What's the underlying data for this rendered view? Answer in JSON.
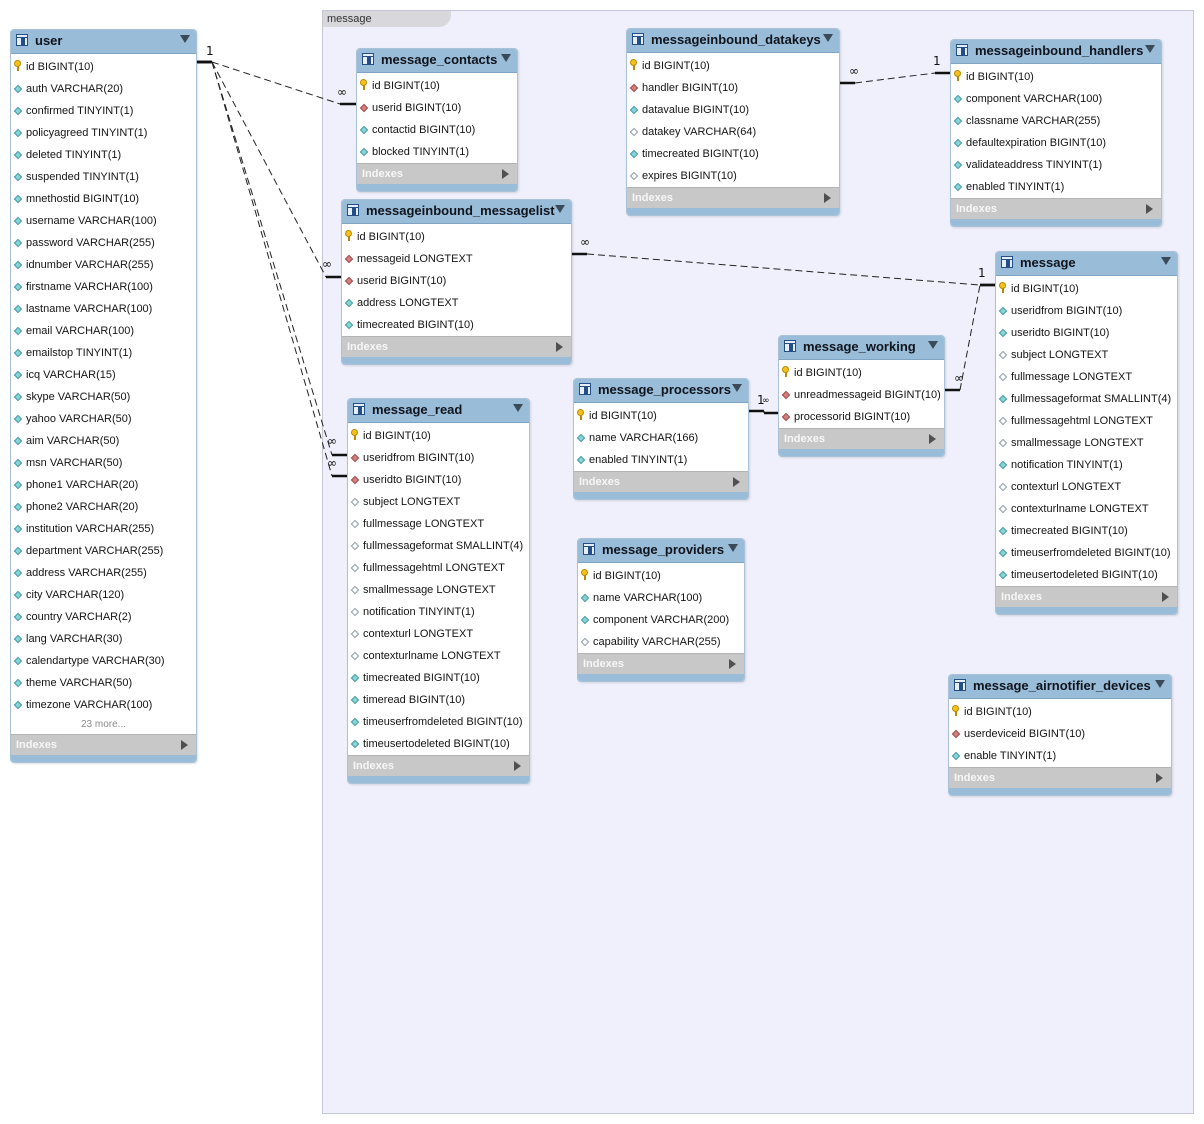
{
  "group": {
    "label": "message"
  },
  "tables": [
    {
      "id": "user",
      "name": "user",
      "columns": [
        {
          "t": "pk",
          "text": "id BIGINT(10)"
        },
        {
          "t": "nn",
          "text": "auth VARCHAR(20)"
        },
        {
          "t": "nn",
          "text": "confirmed TINYINT(1)"
        },
        {
          "t": "nn",
          "text": "policyagreed TINYINT(1)"
        },
        {
          "t": "nn",
          "text": "deleted TINYINT(1)"
        },
        {
          "t": "nn",
          "text": "suspended TINYINT(1)"
        },
        {
          "t": "nn",
          "text": "mnethostid BIGINT(10)"
        },
        {
          "t": "nn",
          "text": "username VARCHAR(100)"
        },
        {
          "t": "nn",
          "text": "password VARCHAR(255)"
        },
        {
          "t": "nn",
          "text": "idnumber VARCHAR(255)"
        },
        {
          "t": "nn",
          "text": "firstname VARCHAR(100)"
        },
        {
          "t": "nn",
          "text": "lastname VARCHAR(100)"
        },
        {
          "t": "nn",
          "text": "email VARCHAR(100)"
        },
        {
          "t": "nn",
          "text": "emailstop TINYINT(1)"
        },
        {
          "t": "nn",
          "text": "icq VARCHAR(15)"
        },
        {
          "t": "nn",
          "text": "skype VARCHAR(50)"
        },
        {
          "t": "nn",
          "text": "yahoo VARCHAR(50)"
        },
        {
          "t": "nn",
          "text": "aim VARCHAR(50)"
        },
        {
          "t": "nn",
          "text": "msn VARCHAR(50)"
        },
        {
          "t": "nn",
          "text": "phone1 VARCHAR(20)"
        },
        {
          "t": "nn",
          "text": "phone2 VARCHAR(20)"
        },
        {
          "t": "nn",
          "text": "institution VARCHAR(255)"
        },
        {
          "t": "nn",
          "text": "department VARCHAR(255)"
        },
        {
          "t": "nn",
          "text": "address VARCHAR(255)"
        },
        {
          "t": "nn",
          "text": "city VARCHAR(120)"
        },
        {
          "t": "nn",
          "text": "country VARCHAR(2)"
        },
        {
          "t": "nn",
          "text": "lang VARCHAR(30)"
        },
        {
          "t": "nn",
          "text": "calendartype VARCHAR(30)"
        },
        {
          "t": "nn",
          "text": "theme VARCHAR(50)"
        },
        {
          "t": "nn",
          "text": "timezone VARCHAR(100)"
        }
      ],
      "more": "23 more...",
      "footer": "Indexes"
    },
    {
      "id": "message_contacts",
      "name": "message_contacts",
      "columns": [
        {
          "t": "pk",
          "text": "id BIGINT(10)"
        },
        {
          "t": "fk",
          "text": "userid BIGINT(10)"
        },
        {
          "t": "nn",
          "text": "contactid BIGINT(10)"
        },
        {
          "t": "nn",
          "text": "blocked TINYINT(1)"
        }
      ],
      "footer": "Indexes"
    },
    {
      "id": "messageinbound_datakeys",
      "name": "messageinbound_datakeys",
      "columns": [
        {
          "t": "pk",
          "text": "id BIGINT(10)"
        },
        {
          "t": "fk",
          "text": "handler BIGINT(10)"
        },
        {
          "t": "nn",
          "text": "datavalue BIGINT(10)"
        },
        {
          "t": "col",
          "text": "datakey VARCHAR(64)"
        },
        {
          "t": "nn",
          "text": "timecreated BIGINT(10)"
        },
        {
          "t": "col",
          "text": "expires BIGINT(10)"
        }
      ],
      "footer": "Indexes"
    },
    {
      "id": "messageinbound_handlers",
      "name": "messageinbound_handlers",
      "columns": [
        {
          "t": "pk",
          "text": "id BIGINT(10)"
        },
        {
          "t": "nn",
          "text": "component VARCHAR(100)"
        },
        {
          "t": "nn",
          "text": "classname VARCHAR(255)"
        },
        {
          "t": "nn",
          "text": "defaultexpiration BIGINT(10)"
        },
        {
          "t": "nn",
          "text": "validateaddress TINYINT(1)"
        },
        {
          "t": "nn",
          "text": "enabled TINYINT(1)"
        }
      ],
      "footer": "Indexes"
    },
    {
      "id": "messageinbound_messagelist",
      "name": "messageinbound_messagelist",
      "columns": [
        {
          "t": "pk",
          "text": "id BIGINT(10)"
        },
        {
          "t": "fk",
          "text": "messageid LONGTEXT"
        },
        {
          "t": "fk",
          "text": "userid BIGINT(10)"
        },
        {
          "t": "nn",
          "text": "address LONGTEXT"
        },
        {
          "t": "nn",
          "text": "timecreated BIGINT(10)"
        }
      ],
      "footer": "Indexes"
    },
    {
      "id": "message",
      "name": "message",
      "columns": [
        {
          "t": "pk",
          "text": "id BIGINT(10)"
        },
        {
          "t": "nn",
          "text": "useridfrom BIGINT(10)"
        },
        {
          "t": "nn",
          "text": "useridto BIGINT(10)"
        },
        {
          "t": "col",
          "text": "subject LONGTEXT"
        },
        {
          "t": "col",
          "text": "fullmessage LONGTEXT"
        },
        {
          "t": "nn",
          "text": "fullmessageformat SMALLINT(4)"
        },
        {
          "t": "col",
          "text": "fullmessagehtml LONGTEXT"
        },
        {
          "t": "col",
          "text": "smallmessage LONGTEXT"
        },
        {
          "t": "nn",
          "text": "notification TINYINT(1)"
        },
        {
          "t": "col",
          "text": "contexturl LONGTEXT"
        },
        {
          "t": "col",
          "text": "contexturlname LONGTEXT"
        },
        {
          "t": "nn",
          "text": "timecreated BIGINT(10)"
        },
        {
          "t": "nn",
          "text": "timeuserfromdeleted BIGINT(10)"
        },
        {
          "t": "nn",
          "text": "timeusertodeleted BIGINT(10)"
        }
      ],
      "footer": "Indexes"
    },
    {
      "id": "message_working",
      "name": "message_working",
      "columns": [
        {
          "t": "pk",
          "text": "id BIGINT(10)"
        },
        {
          "t": "fk",
          "text": "unreadmessageid BIGINT(10)"
        },
        {
          "t": "fk",
          "text": "processorid BIGINT(10)"
        }
      ],
      "footer": "Indexes"
    },
    {
      "id": "message_processors",
      "name": "message_processors",
      "columns": [
        {
          "t": "pk",
          "text": "id BIGINT(10)"
        },
        {
          "t": "nn",
          "text": "name VARCHAR(166)"
        },
        {
          "t": "nn",
          "text": "enabled TINYINT(1)"
        }
      ],
      "footer": "Indexes"
    },
    {
      "id": "message_read",
      "name": "message_read",
      "columns": [
        {
          "t": "pk",
          "text": "id BIGINT(10)"
        },
        {
          "t": "fk",
          "text": "useridfrom BIGINT(10)"
        },
        {
          "t": "fk",
          "text": "useridto BIGINT(10)"
        },
        {
          "t": "col",
          "text": "subject LONGTEXT"
        },
        {
          "t": "col",
          "text": "fullmessage LONGTEXT"
        },
        {
          "t": "col",
          "text": "fullmessageformat SMALLINT(4)"
        },
        {
          "t": "col",
          "text": "fullmessagehtml LONGTEXT"
        },
        {
          "t": "col",
          "text": "smallmessage LONGTEXT"
        },
        {
          "t": "col",
          "text": "notification TINYINT(1)"
        },
        {
          "t": "col",
          "text": "contexturl LONGTEXT"
        },
        {
          "t": "col",
          "text": "contexturlname LONGTEXT"
        },
        {
          "t": "nn",
          "text": "timecreated BIGINT(10)"
        },
        {
          "t": "nn",
          "text": "timeread BIGINT(10)"
        },
        {
          "t": "nn",
          "text": "timeuserfromdeleted BIGINT(10)"
        },
        {
          "t": "nn",
          "text": "timeusertodeleted BIGINT(10)"
        }
      ],
      "footer": "Indexes"
    },
    {
      "id": "message_providers",
      "name": "message_providers",
      "columns": [
        {
          "t": "pk",
          "text": "id BIGINT(10)"
        },
        {
          "t": "nn",
          "text": "name VARCHAR(100)"
        },
        {
          "t": "nn",
          "text": "component VARCHAR(200)"
        },
        {
          "t": "col",
          "text": "capability VARCHAR(255)"
        }
      ],
      "footer": "Indexes"
    },
    {
      "id": "message_airnotifier_devices",
      "name": "message_airnotifier_devices",
      "columns": [
        {
          "t": "pk",
          "text": "id BIGINT(10)"
        },
        {
          "t": "fk",
          "text": "userdeviceid BIGINT(10)"
        },
        {
          "t": "nn",
          "text": "enable TINYINT(1)"
        }
      ],
      "footer": "Indexes"
    }
  ],
  "relationship_labels": {
    "one": "1",
    "many": "∞"
  }
}
